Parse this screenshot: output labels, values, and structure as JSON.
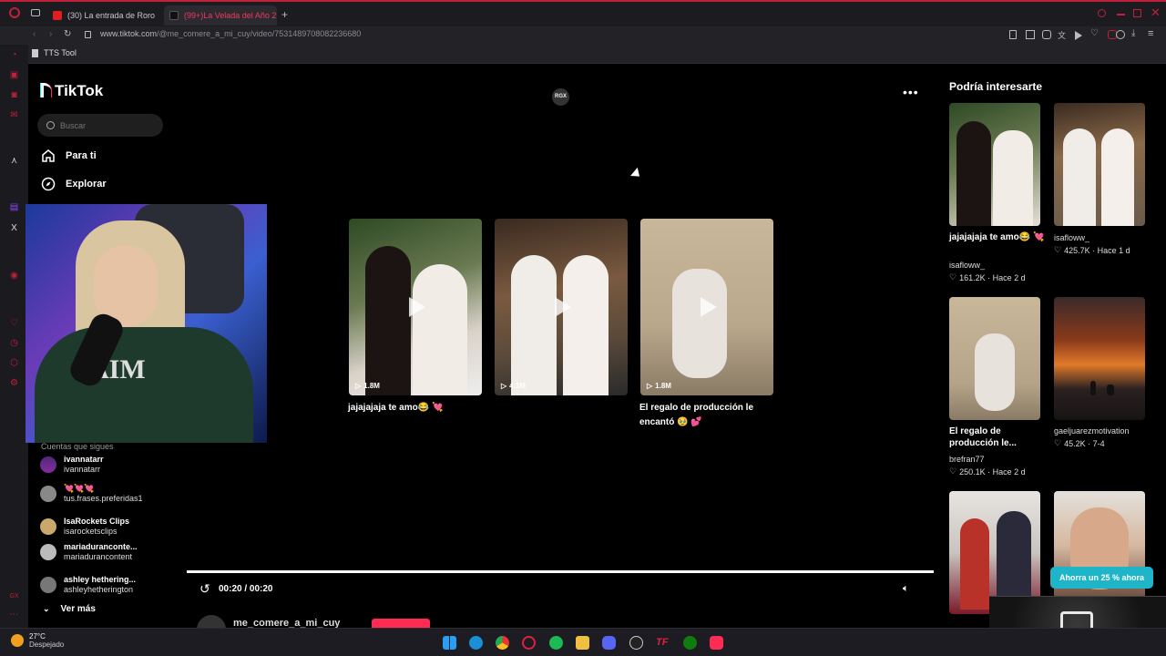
{
  "browser": {
    "tabs": [
      {
        "label": "(30) La entrada de Roro f",
        "active": false
      },
      {
        "label": "(99+)La Velada del Año 2",
        "active": true
      }
    ],
    "url_host": "www.tiktok.com",
    "url_path": "/@me_comere_a_mi_cuy/video/7531489708082236680",
    "bookmark": "TTS Tool"
  },
  "tiktok": {
    "logo": "TikTok",
    "search_placeholder": "Buscar",
    "nav": [
      {
        "label": "Para ti",
        "icon": "home-icon"
      },
      {
        "label": "Explorar",
        "icon": "compass-icon"
      }
    ],
    "following_header": "Cuentas que sigues",
    "following": [
      {
        "name": "ivannatarr",
        "handle": "ivannatarr"
      },
      {
        "name": "💘💘💘",
        "handle": "tus.frases.preferidas1"
      },
      {
        "name": "IsaRockets Clips",
        "handle": "isarocketsclips"
      },
      {
        "name": "mariaduranconte...",
        "handle": "mariaduranconten​t"
      },
      {
        "name": "ashley hethering...",
        "handle": "ashleyhetherington"
      }
    ],
    "see_more": "Ver más",
    "player": {
      "channel_badge": "RGX",
      "grid_videos": [
        {
          "views": "1.8M",
          "title": "jajajajaja te amo😂 💘"
        },
        {
          "views": "4.1M",
          "title": ""
        },
        {
          "views": "1.8M",
          "title": "El regalo de producción le encantó 🥹 💕"
        }
      ],
      "time": "00:20 / 00:20",
      "progress": 1.0,
      "author": "me_comere_a_mi_cuy"
    },
    "recommend_header": "Podría interesarte",
    "recommend": [
      {
        "title": "jajajajaja te amo😂 💘",
        "user": "isafloww_",
        "likes": "161.2K",
        "when": "Hace 2 d"
      },
      {
        "title": "",
        "user": "isafloww_",
        "likes": "425.7K",
        "when": "Hace 1 d"
      },
      {
        "title": "El regalo de producción le...",
        "user": "brefran77",
        "likes": "250.1K",
        "when": "Hace 2 d"
      },
      {
        "title": "",
        "user": "gaeljuarezmotivation",
        "likes": "45.2K",
        "when": "7-4"
      },
      {
        "title": "",
        "user": "",
        "likes": "",
        "when": ""
      },
      {
        "title": "",
        "user": "",
        "likes": "",
        "when": ""
      }
    ],
    "promo": "Ahorra un 25 % ahora"
  },
  "taskbar": {
    "weather_temp": "27°C",
    "weather_desc": "Despejado"
  },
  "colors": {
    "accent": "#c0203a",
    "tiktok_red": "#fe2c55",
    "promo": "#1fb5c9"
  }
}
